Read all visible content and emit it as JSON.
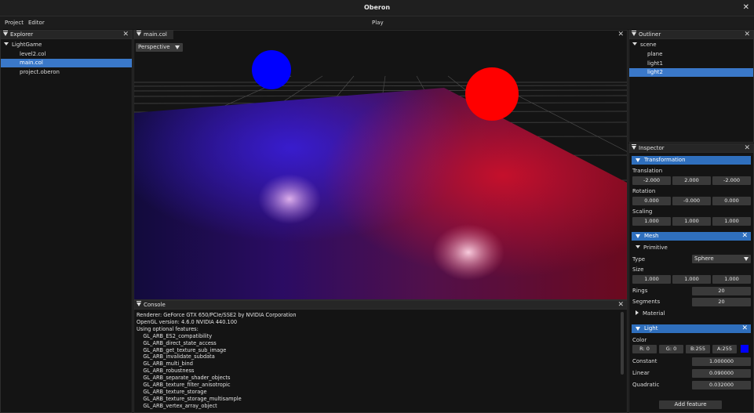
{
  "window": {
    "title": "Oberon",
    "close_glyph": "✕"
  },
  "menubar": {
    "items": [
      "Project",
      "Editor"
    ],
    "play_label": "Play"
  },
  "explorer": {
    "title": "Explorer",
    "root": "LightGame",
    "files": [
      "level2.col",
      "main.col",
      "project.oberon"
    ],
    "selected": "main.col"
  },
  "viewport": {
    "tab": "main.col",
    "camera_mode": "Perspective"
  },
  "console": {
    "title": "Console",
    "lines": [
      "Renderer: GeForce GTX 650/PCIe/SSE2 by NVIDIA Corporation",
      "OpenGL version: 4.6.0 NVIDIA 440.100",
      "Using optional features:",
      "    GL_ARB_ES2_compatibility",
      "    GL_ARB_direct_state_access",
      "    GL_ARB_get_texture_sub_image",
      "    GL_ARB_invalidate_subdata",
      "    GL_ARB_multi_bind",
      "    GL_ARB_robustness",
      "    GL_ARB_separate_shader_objects",
      "    GL_ARB_texture_filter_anisotropic",
      "    GL_ARB_texture_storage",
      "    GL_ARB_texture_storage_multisample",
      "    GL_ARB_vertex_array_object"
    ]
  },
  "outliner": {
    "title": "Outliner",
    "root": "scene",
    "children": [
      "plane",
      "light1",
      "light2"
    ],
    "selected": "light2"
  },
  "inspector": {
    "title": "Inspector",
    "transformation": {
      "header": "Transformation",
      "translation_label": "Translation",
      "translation": [
        "-2.000",
        "2.000",
        "-2.000"
      ],
      "rotation_label": "Rotation",
      "rotation": [
        "0.000",
        "-0.000",
        "0.000"
      ],
      "scaling_label": "Scaling",
      "scaling": [
        "1.000",
        "1.000",
        "1.000"
      ]
    },
    "mesh": {
      "header": "Mesh",
      "primitive_label": "Primitive",
      "type_label": "Type",
      "type_value": "Sphere",
      "size_label": "Size",
      "size": [
        "1.000",
        "1.000",
        "1.000"
      ],
      "rings_label": "Rings",
      "rings": "20",
      "segments_label": "Segments",
      "segments": "20",
      "material_label": "Material"
    },
    "light": {
      "header": "Light",
      "color_label": "Color",
      "r": "R:  0",
      "g": "G:  0",
      "b": "B:255",
      "a": "A:255",
      "swatch_color": "#0000ff",
      "constant_label": "Constant",
      "constant": "1.000000",
      "linear_label": "Linear",
      "linear": "0.090000",
      "quadratic_label": "Quadratic",
      "quadratic": "0.032000"
    },
    "add_feature": "Add feature"
  },
  "colors": {
    "selection": "#3a78c9",
    "section": "#2f6fbd"
  }
}
